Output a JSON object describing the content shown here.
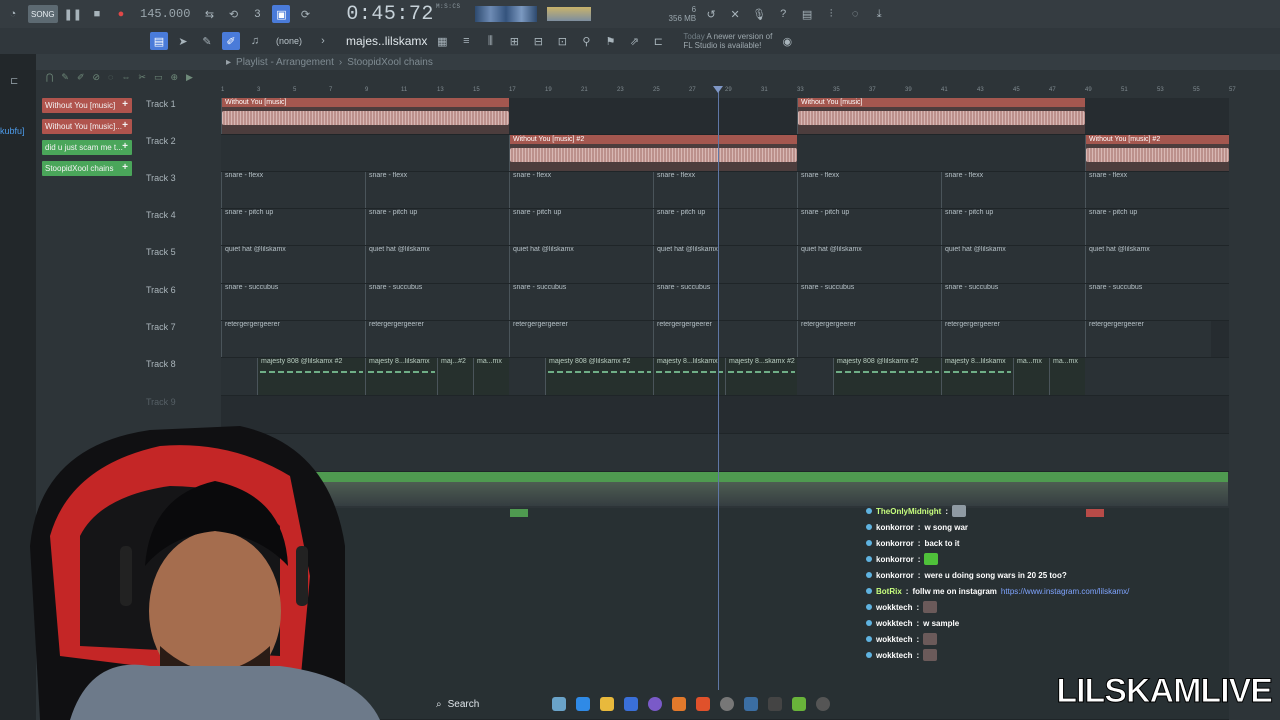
{
  "topbar": {
    "song_label": "SONG",
    "tempo": "145.000",
    "time_main": "0:45:72",
    "time_unit": "M:S:CS",
    "mem_top": "6",
    "mem_bottom": "356 MB"
  },
  "toolbar2": {
    "pattern_none": "(none)",
    "pattern_name": "majes..lilskamx",
    "news_label": "Today",
    "news_text_1": "A newer version of",
    "news_text_2": "FL Studio is available!"
  },
  "browser": {
    "snippet": "kubfu]"
  },
  "playlist": {
    "title": "Playlist - Arrangement",
    "arrangement": "StoopidXool chains",
    "picker_clips": [
      {
        "label": "Without You [music]",
        "color": "#b0544d"
      },
      {
        "label": "Without You [music]...",
        "color": "#b0544d"
      },
      {
        "label": "did u just scam me t...",
        "color": "#4aa65a"
      },
      {
        "label": "StoopidXool chains",
        "color": "#4aa65a"
      }
    ],
    "tracks": [
      {
        "name": "Track 1"
      },
      {
        "name": "Track 2"
      },
      {
        "name": "Track 3"
      },
      {
        "name": "Track 4"
      },
      {
        "name": "Track 5"
      },
      {
        "name": "Track 6"
      },
      {
        "name": "Track 7"
      },
      {
        "name": "Track 8"
      },
      {
        "name": "Track 9"
      }
    ],
    "ruler_numbers": [
      "1",
      "3",
      "5",
      "7",
      "9",
      "11",
      "13",
      "15",
      "17",
      "19",
      "21",
      "23",
      "25",
      "27",
      "29",
      "31",
      "33",
      "35",
      "37",
      "39",
      "41",
      "43",
      "45",
      "47",
      "49",
      "51",
      "53",
      "55",
      "57"
    ],
    "clip_labels": {
      "t1": "Without You [music]",
      "t2": "Without You [music] #2",
      "t3": "snare - flexx",
      "t4": "snare - pitch up",
      "t5": "quiet hat @lilskamx",
      "t6": "snare - succubus",
      "t7": "retergergergeerer",
      "t8a": "majesty 808 @lilskamx #2",
      "t8b": "majesty 8...lilskamx",
      "t8c": "maj...#2",
      "t8d": "ma...mx",
      "t8e": "majesty 8...skamx #2"
    }
  },
  "chat": [
    {
      "user": "TheOnlyMidnight",
      "msg": "",
      "user_color": "#c8ff7f"
    },
    {
      "user": "konkorror",
      "msg": "w song war",
      "user_color": "#ffffff"
    },
    {
      "user": "konkorror",
      "msg": "back to it",
      "user_color": "#ffffff"
    },
    {
      "user": "konkorror",
      "msg": "",
      "user_color": "#ffffff"
    },
    {
      "user": "konkorror",
      "msg": "were u doing song wars in 20 25 too?",
      "user_color": "#ffffff"
    },
    {
      "user": "BotRix",
      "msg": "follw me on instagram",
      "url": "https://www.instagram.com/lilskamx/",
      "user_color": "#c8ff7f"
    },
    {
      "user": "wokktech",
      "msg": "",
      "user_color": "#ffffff"
    },
    {
      "user": "wokktech",
      "msg": "w sample",
      "user_color": "#ffffff"
    },
    {
      "user": "wokktech",
      "msg": "",
      "user_color": "#ffffff"
    },
    {
      "user": "wokktech",
      "msg": "",
      "user_color": "#ffffff"
    }
  ],
  "taskbar": {
    "search_label": "Search"
  },
  "watermark": "LILSKAMLIVE",
  "colors": {
    "audio_clip": "#a4574f",
    "pattern_green": "#4aa65a",
    "automation": "#4f9a50",
    "playhead": "#5f77a6",
    "accent_blue": "#4a7bd9"
  }
}
